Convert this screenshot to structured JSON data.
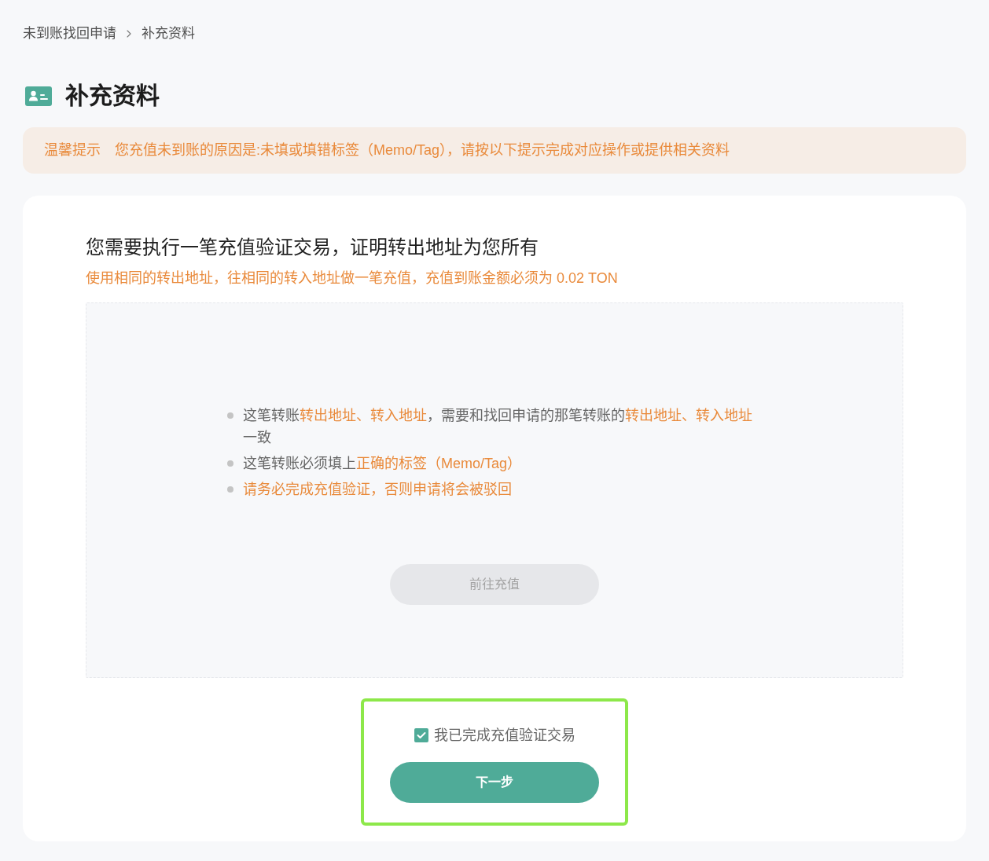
{
  "breadcrumb": [
    {
      "label": "未到账找回申请"
    },
    {
      "label": "补充资料"
    }
  ],
  "page_title": "补充资料",
  "notice": {
    "label": "温馨提示",
    "message": "您充值未到账的原因是:未填或填错标签（Memo/Tag），请按以下提示完成对应操作或提供相关资料"
  },
  "verification": {
    "heading": "您需要执行一笔充值验证交易，证明转出地址为您所有",
    "instruction": "使用相同的转出地址，往相同的转入地址做一笔充值，充值到账金额必须为 0.02 TON",
    "requirements": [
      {
        "segments": [
          {
            "text": "这笔转账",
            "highlight": false
          },
          {
            "text": "转出地址、转入地址",
            "highlight": true
          },
          {
            "text": "，需要和找回申请的那笔转账的",
            "highlight": false
          },
          {
            "text": "转出地址、转入地址",
            "highlight": true
          },
          {
            "text": "一致",
            "highlight": false
          }
        ]
      },
      {
        "segments": [
          {
            "text": "这笔转账必须填上",
            "highlight": false
          },
          {
            "text": "正确的标签（Memo/Tag）",
            "highlight": true
          }
        ]
      },
      {
        "segments": [
          {
            "text": "请务必完成充值验证，否则申请将会被驳回",
            "highlight": true
          }
        ]
      }
    ],
    "recharge_button": {
      "label": "前往充值",
      "disabled": true
    }
  },
  "confirmation": {
    "checkbox": {
      "label": "我已完成充值验证交易",
      "checked": true
    },
    "next_button": {
      "label": "下一步",
      "disabled": false
    }
  }
}
